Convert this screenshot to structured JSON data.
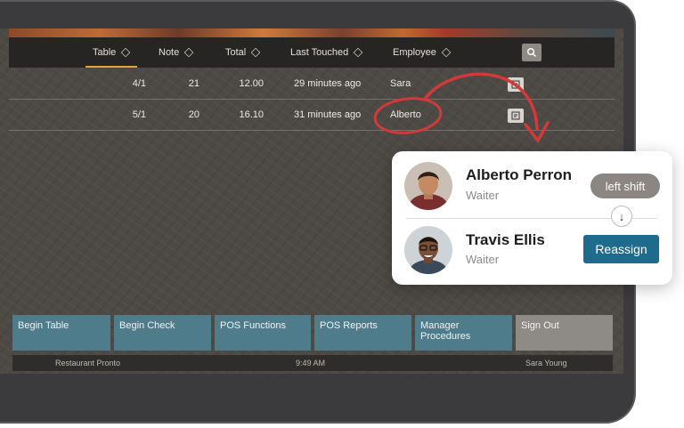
{
  "table_headers": [
    "Table",
    "Note",
    "Total",
    "Last Touched",
    "Employee"
  ],
  "rows": [
    {
      "table": "4/1",
      "note": "21",
      "total": "12.00",
      "last_touched": "29 minutes ago",
      "employee": "Sara"
    },
    {
      "table": "5/1",
      "note": "20",
      "total": "16.10",
      "last_touched": "31 minutes ago",
      "employee": "Alberto"
    }
  ],
  "buttons": [
    "Begin Table",
    "Begin Check",
    "POS Functions",
    "POS Reports",
    "Manager Procedures",
    "Sign Out"
  ],
  "status": {
    "restaurant": "Restaurant Pronto",
    "time": "9:49 AM",
    "user": "Sara Young"
  },
  "card": {
    "from": {
      "name": "Alberto Perron",
      "role": "Waiter",
      "badge": "left shift"
    },
    "to": {
      "name": "Travis Ellis",
      "role": "Waiter",
      "action": "Reassign"
    }
  },
  "colors": {
    "accent": "#e6a23c",
    "button": "#4f7c8a",
    "reassign": "#1f6b8e",
    "annotation": "#d23a3a"
  }
}
